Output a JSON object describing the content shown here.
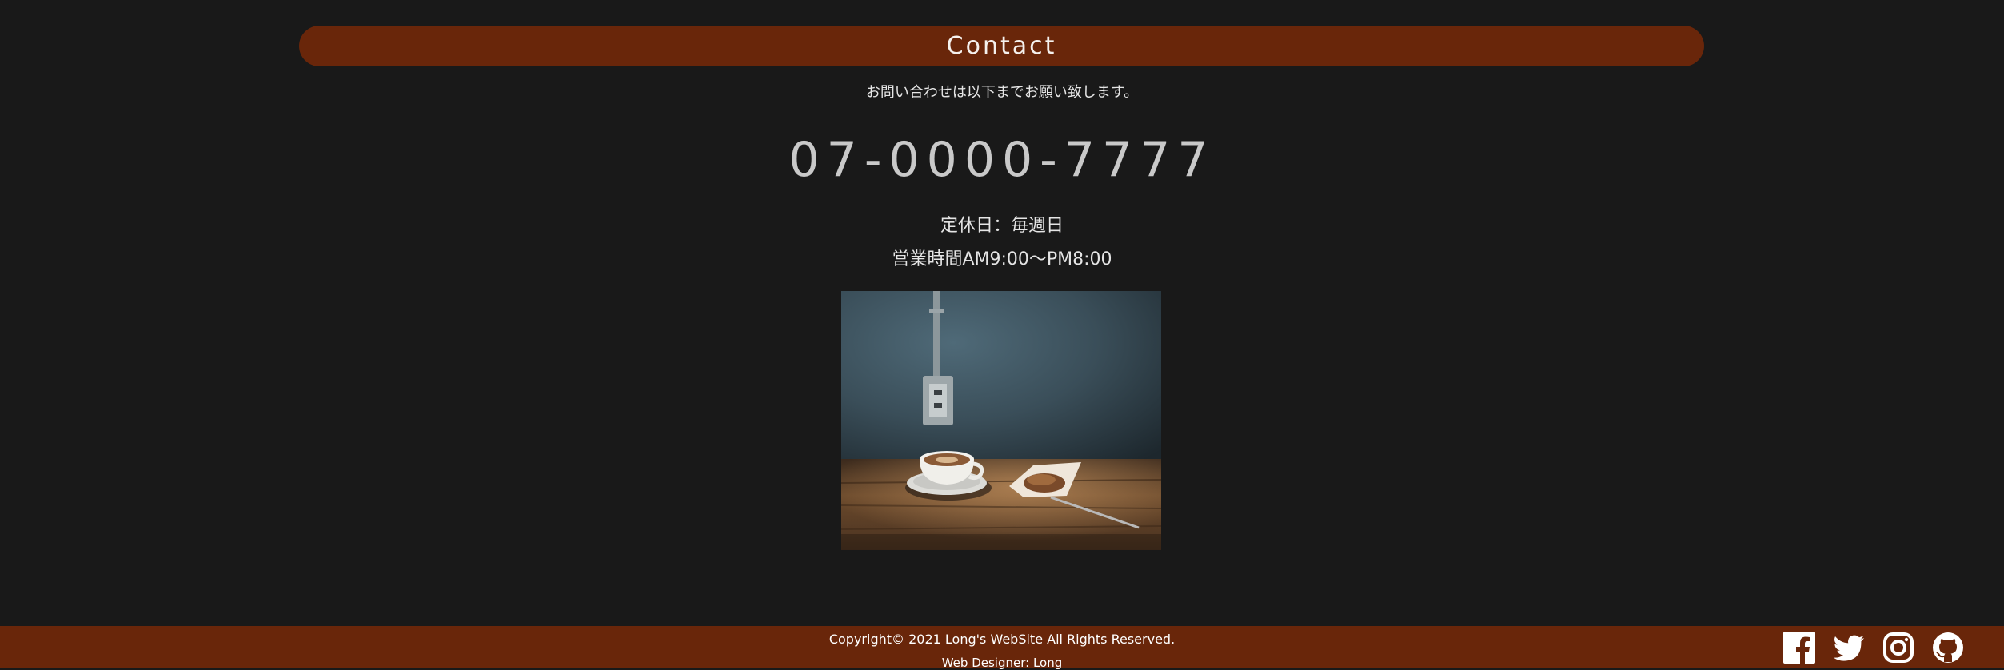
{
  "contact": {
    "title": "Contact",
    "intro": "お問い合わせは以下までお願い致します。",
    "phone": "07-0000-7777",
    "closed_day": "定休日：毎週日",
    "hours": "営業時間AM9:00〜PM8:00"
  },
  "footer": {
    "copyright": "Copyright© 2021 Long's WebSite All Rights Reserved.",
    "designer": "Web Designer: Long",
    "social": [
      "facebook-icon",
      "twitter-icon",
      "instagram-icon",
      "github-icon"
    ]
  },
  "colors": {
    "background": "#191919",
    "accent": "#69260a",
    "text": "#e9e9e9",
    "phone": "#c9c9c9"
  }
}
